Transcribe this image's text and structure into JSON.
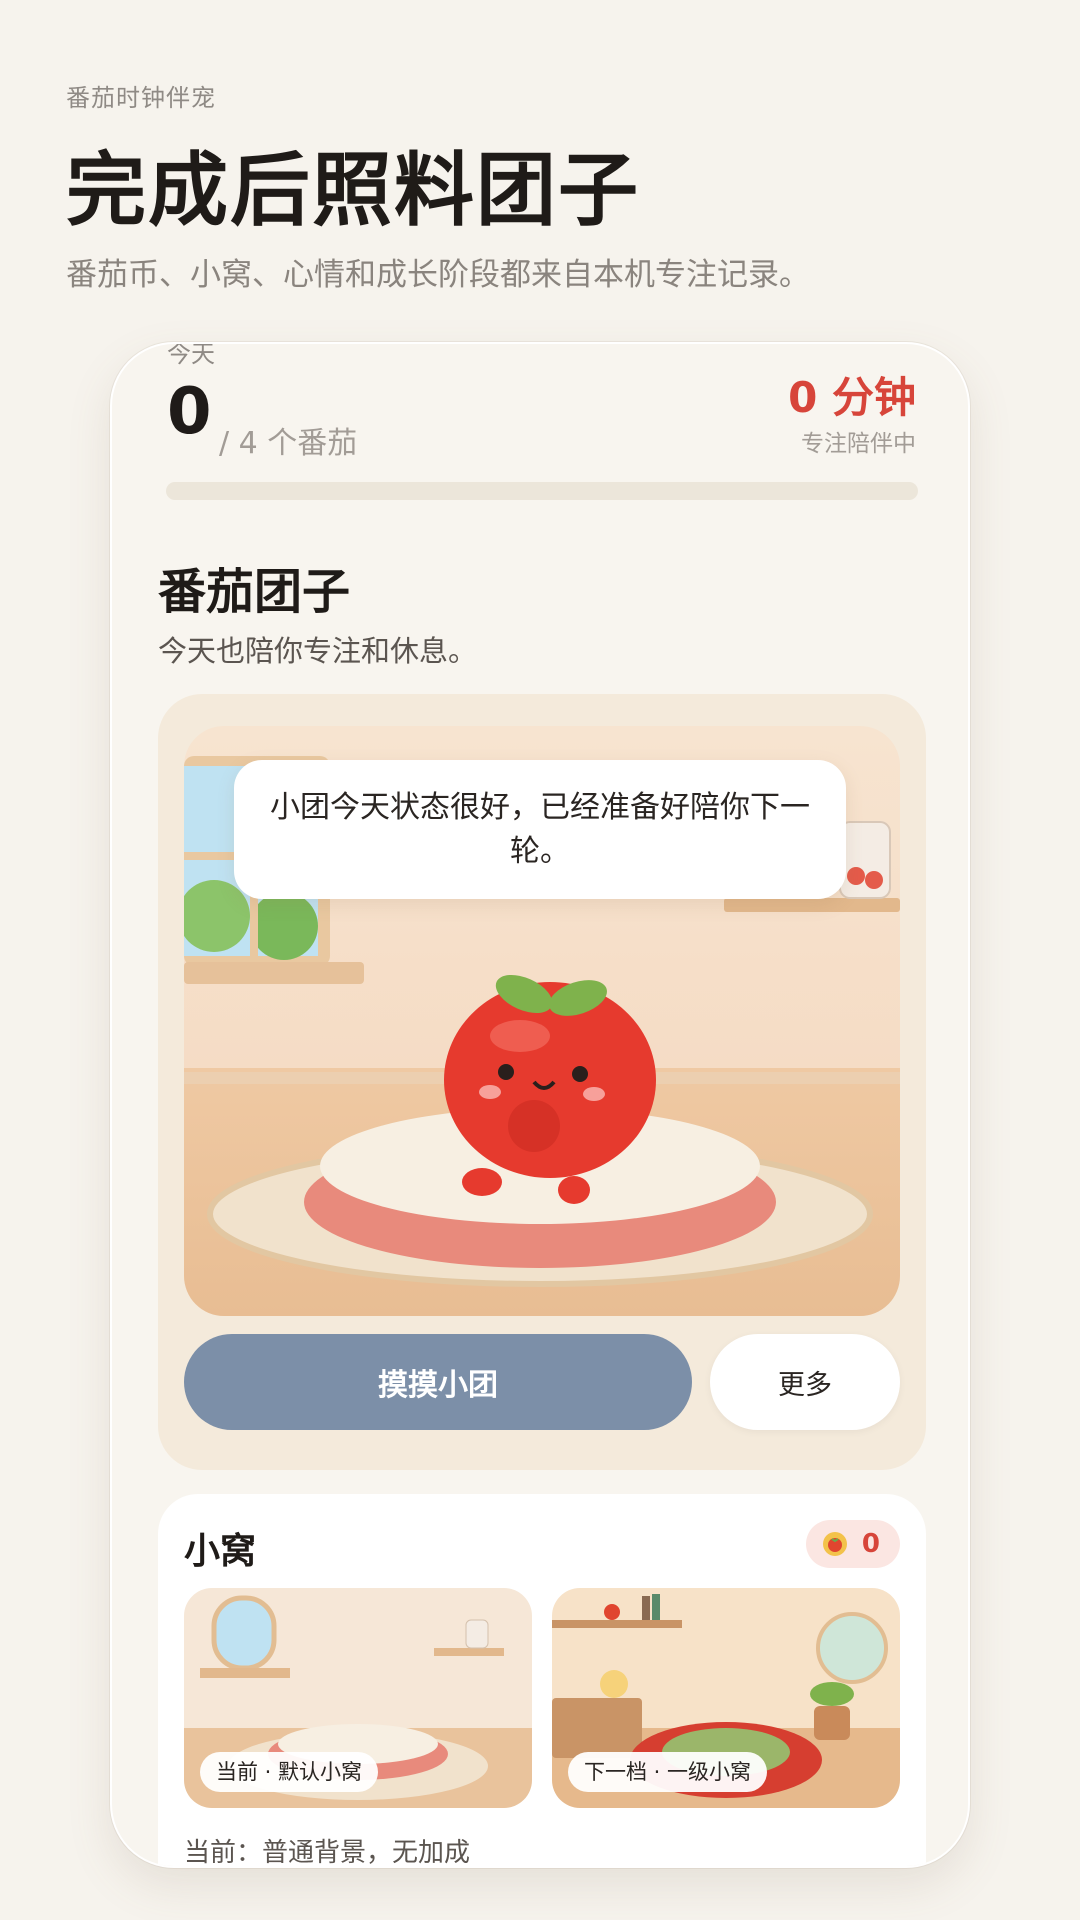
{
  "header": {
    "eyebrow": "番茄时钟伴宠",
    "title": "完成后照料团子",
    "subtitle": "番茄币、小窝、心情和成长阶段都来自本机专注记录。"
  },
  "stats": {
    "label": "今天",
    "count": "0",
    "goal": "/ 4 个番茄",
    "minutes": "0 分钟",
    "status": "专注陪伴中",
    "progress_fraction": 0
  },
  "pet": {
    "name": "番茄团子",
    "description": "今天也陪你专注和休息。",
    "speech": "小团今天状态很好，已经准备好陪你下一轮。",
    "pet_button": "摸摸小团",
    "more_button": "更多"
  },
  "nest": {
    "title": "小窝",
    "coins": "0",
    "coin_icon": "tomato-coin-icon",
    "current_tag": "当前 · 默认小窝",
    "next_tag": "下一档 · 一级小窝",
    "note": "当前：普通背景，无加成"
  },
  "colors": {
    "accent": "#d7453a",
    "button": "#7c8fa8",
    "background": "#f6f3ed"
  }
}
